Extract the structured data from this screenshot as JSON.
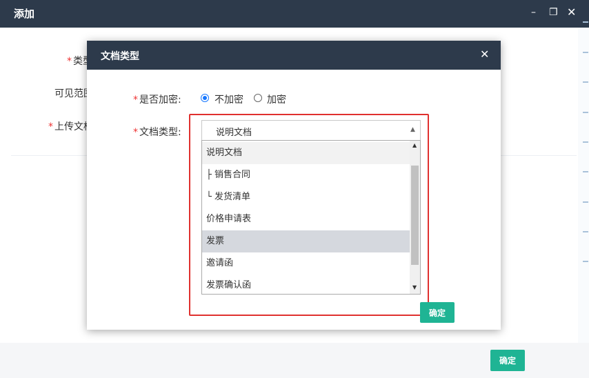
{
  "outer": {
    "title": "添加",
    "controls": {
      "minimize": "–",
      "maximize": "❐",
      "close": "✕"
    },
    "fields": {
      "type_label": "类型",
      "visibility_label": "可见范围",
      "upload_label": "上传文档"
    },
    "confirm_label": "确定"
  },
  "modal": {
    "title": "文档类型",
    "close_icon": "✕",
    "encrypt": {
      "label": "是否加密:",
      "options": [
        "不加密",
        "加密"
      ],
      "selected": "不加密"
    },
    "doc_type": {
      "label": "文档类型:",
      "value": "说明文档",
      "arrow_icon": "▲",
      "options": [
        "说明文档",
        "├ 销售合同",
        "└ 发货清单",
        "价格申请表",
        "发票",
        "邀请函",
        "发票确认函"
      ],
      "highlighted": "发票"
    },
    "scroll_icons": {
      "up": "▲",
      "down": "▼"
    },
    "confirm_label": "确定"
  },
  "colors": {
    "header": "#2d3a4b",
    "accent": "#1fb494",
    "radio": "#1677ff",
    "highlight_frame": "#e0302e"
  }
}
